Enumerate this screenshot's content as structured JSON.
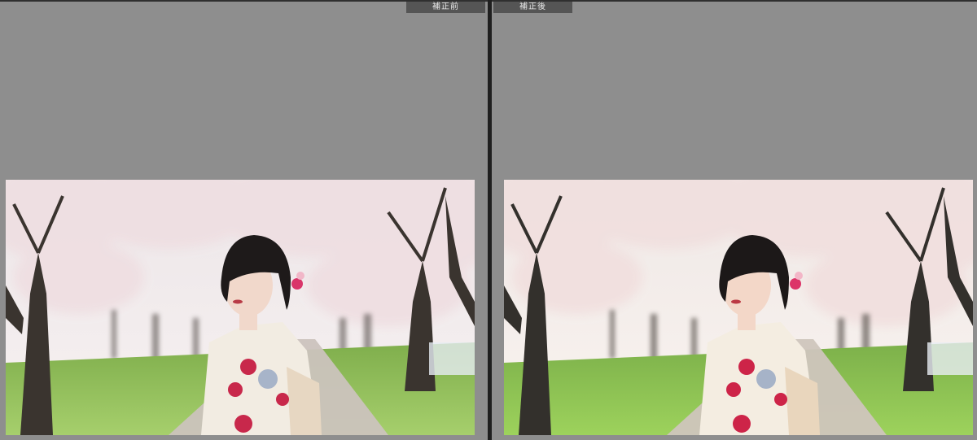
{
  "panels": {
    "before": {
      "label": "補正前"
    },
    "after": {
      "label": "補正後"
    }
  },
  "photo": {
    "subject": "woman-in-kimono-cherry-blossoms",
    "colors": {
      "sky": "#efe9ea",
      "blossom": "#f3e6e8",
      "trunk": "#3b3530",
      "grass": "#8fc25a",
      "path": "#c9c1bb",
      "kimono": "#f2ece2",
      "flower_red": "#c8284b",
      "flower_blue": "#a7b4c9",
      "hair": "#1e1a1a",
      "skin": "#f1d8cb"
    }
  }
}
